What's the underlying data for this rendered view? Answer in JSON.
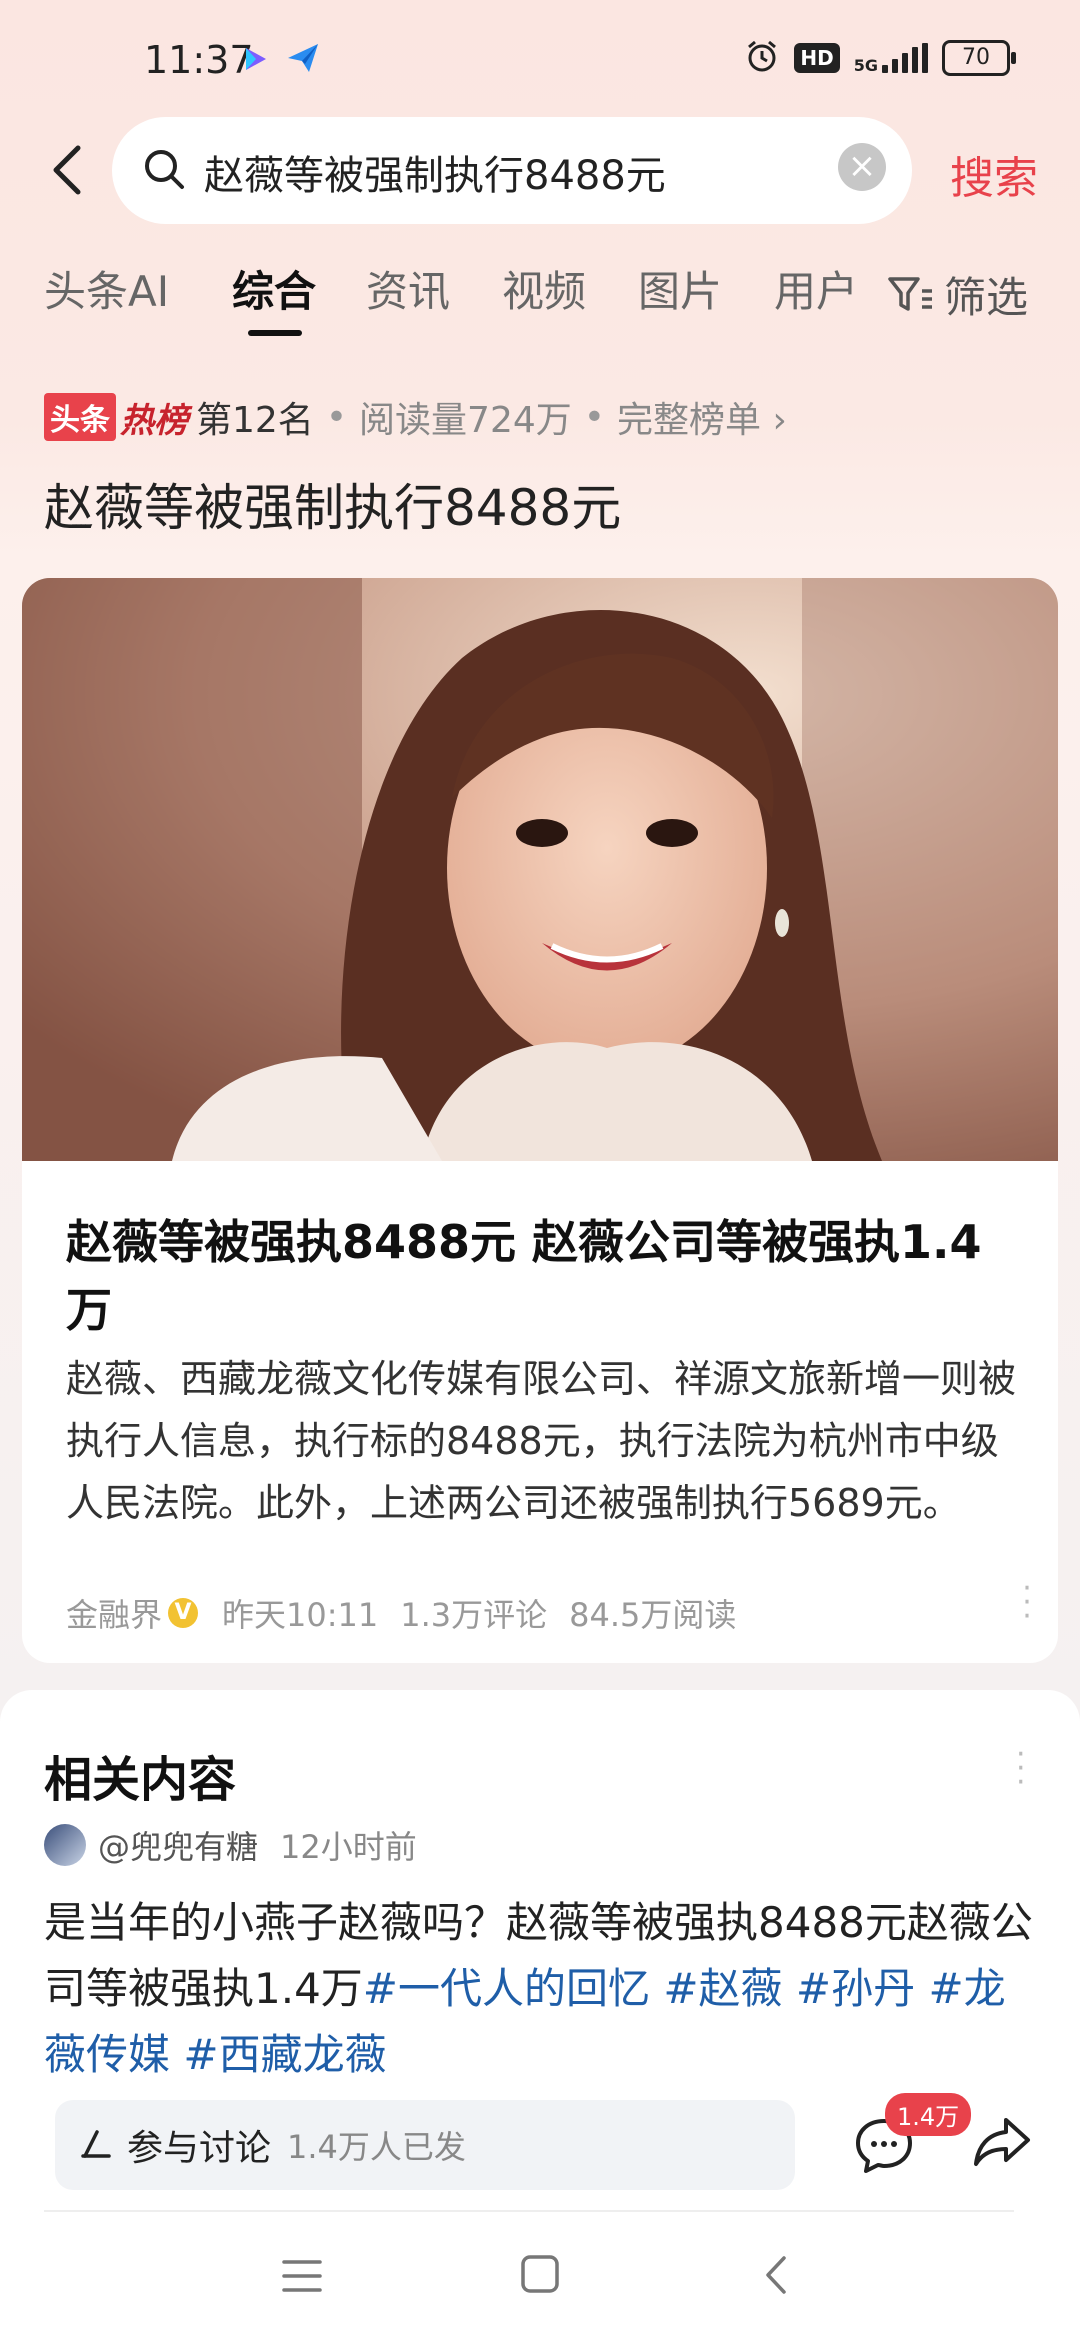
{
  "status_bar": {
    "time": "11:37",
    "network": "5G",
    "hd": "HD",
    "battery": "70"
  },
  "search": {
    "query": "赵薇等被强制执行8488元",
    "submit_label": "搜索"
  },
  "tabs": [
    {
      "label": "头条AI",
      "active": false
    },
    {
      "label": "综合",
      "active": true
    },
    {
      "label": "资讯",
      "active": false
    },
    {
      "label": "视频",
      "active": false
    },
    {
      "label": "图片",
      "active": false
    },
    {
      "label": "用户",
      "active": false
    }
  ],
  "filter_label": "筛选",
  "hot": {
    "logo_prefix": "头条",
    "logo_suffix": "热榜",
    "rank": "第12名",
    "reads": "阅读量724万",
    "full_list": "完整榜单 ›"
  },
  "page_title": "赵薇等被强制执行8488元",
  "article": {
    "title": "赵薇等被强执8488元 赵薇公司等被强执1.4万",
    "summary": "赵薇、西藏龙薇文化传媒有限公司、祥源文旅新增一则被执行人信息，执行标的8488元，执行法院为杭州市中级人民法院。此外，上述两公司还被强制执行5689元。",
    "source": "金融界",
    "verified_mark": "V",
    "time": "昨天10:11",
    "comments": "1.3万评论",
    "reads": "84.5万阅读"
  },
  "related": {
    "title": "相关内容",
    "author": "@兜兜有糖",
    "time_ago": "12小时前",
    "text": "是当年的小燕子赵薇吗？赵薇等被强执8488元赵薇公司等被强执1.4万",
    "tags": [
      "#一代人的回忆",
      "#赵薇",
      "#孙丹",
      "#龙薇传媒",
      "#西藏龙薇"
    ],
    "discuss_label": "参与讨论",
    "discuss_count": "1.4万人已发",
    "comment_badge": "1.4万"
  },
  "colors": {
    "accent_red": "#e8424b",
    "tag_blue": "#1f5ea8"
  }
}
